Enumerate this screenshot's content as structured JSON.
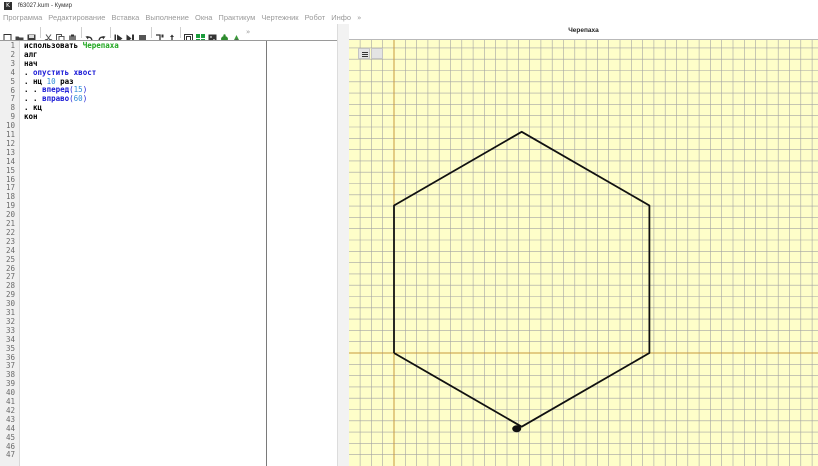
{
  "window": {
    "title": "f63027.kum - Кумир",
    "icon": "kumir-app-icon"
  },
  "menu": {
    "items": [
      "Программа",
      "Редактирование",
      "Вставка",
      "Выполнение",
      "Окна",
      "Практикум",
      "Чертежник",
      "Робот",
      "Инфо"
    ],
    "more": "»"
  },
  "toolbar": {
    "icons": [
      "new-file-icon",
      "open-folder-icon",
      "save-icon",
      "cut-icon",
      "copy-icon",
      "paste-icon",
      "undo-icon",
      "redo-icon",
      "run-icon",
      "step-icon",
      "stop-icon",
      "step-in-icon",
      "step-out-icon",
      "view-icon",
      "grid-icon",
      "robot-icon",
      "turtle-icon",
      "draw-icon"
    ],
    "more": "»"
  },
  "editor": {
    "line_numbers": [
      "1",
      "2",
      "3",
      "4",
      "5",
      "6",
      "7",
      "8",
      "9",
      "10",
      "11",
      "12",
      "13",
      "14",
      "15",
      "16",
      "17",
      "18",
      "19",
      "20",
      "21",
      "22",
      "23",
      "24",
      "25",
      "26",
      "27",
      "28",
      "29",
      "30",
      "31",
      "32",
      "33",
      "34",
      "35",
      "36",
      "37",
      "38",
      "39",
      "40",
      "41",
      "42",
      "43",
      "44",
      "45",
      "46",
      "47"
    ],
    "lines": [
      [
        {
          "t": "использовать ",
          "c": "kw"
        },
        {
          "t": "Черепаха",
          "c": "mod"
        }
      ],
      [
        {
          "t": "алг",
          "c": "kw"
        }
      ],
      [
        {
          "t": "нач",
          "c": "kw"
        }
      ],
      [
        {
          "t": ". ",
          "c": "dots"
        },
        {
          "t": "опустить хвост",
          "c": "cmd"
        }
      ],
      [
        {
          "t": ". ",
          "c": "dots"
        },
        {
          "t": "нц ",
          "c": "kw"
        },
        {
          "t": "10",
          "c": "num"
        },
        {
          "t": " раз",
          "c": "kw"
        }
      ],
      [
        {
          "t": ". . ",
          "c": "dots"
        },
        {
          "t": "вперед",
          "c": "cmd"
        },
        {
          "t": "(",
          "c": "plain"
        },
        {
          "t": "15",
          "c": "num"
        },
        {
          "t": ")",
          "c": "plain"
        }
      ],
      [
        {
          "t": ". . ",
          "c": "dots"
        },
        {
          "t": "вправо",
          "c": "cmd"
        },
        {
          "t": "(",
          "c": "plain"
        },
        {
          "t": "60",
          "c": "num"
        },
        {
          "t": ")",
          "c": "plain"
        }
      ],
      [
        {
          "t": ". ",
          "c": "dots"
        },
        {
          "t": "кц",
          "c": "kw"
        }
      ],
      [
        {
          "t": "кон",
          "c": "kw"
        }
      ]
    ]
  },
  "turtle": {
    "title": "Черепаха",
    "background": "#fefec9",
    "grid_color": "#a3a3a3",
    "axis_color": "#c89a3c",
    "path_color": "#111111"
  }
}
